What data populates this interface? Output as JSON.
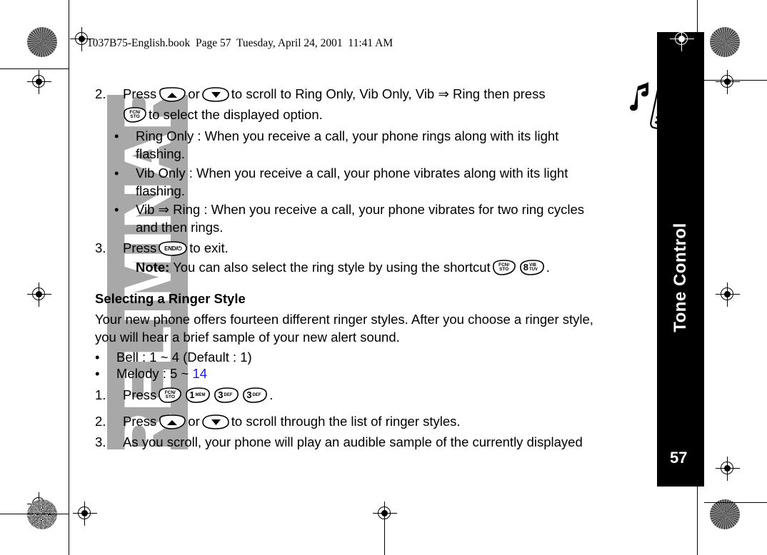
{
  "header": {
    "file_line": "1037B75-English.book  Page 57  Tuesday, April 24, 2001  11:41 AM"
  },
  "watermark": {
    "text": "PRELIMINARY",
    "color": "#a8a8a8"
  },
  "sidebar": {
    "tab_label": "Tone Control",
    "page_number": "57",
    "background": "#000000"
  },
  "keys": {
    "fcn_line1": "FCN/",
    "fcn_line2": "STO",
    "end": "END/⏻",
    "digit_1_num": "1",
    "digit_1_sub": "MEM",
    "digit_3_num": "3",
    "digit_3_sub": "DEF",
    "digit_8_num": "8",
    "digit_8_sub1": "VIB",
    "digit_8_sub2": "TUV"
  },
  "body": {
    "step2_num": "2.",
    "step2_part1": "Press",
    "step2_part2": "or",
    "step2_part3": "to scroll to Ring Only, Vib Only, Vib ⇒ Ring then press",
    "step2_line2": "to select the displayed option.",
    "bullet_marker": "•",
    "b1_line1": "Ring Only : When you receive a call, your phone rings along with its light",
    "b1_line2": "flashing.",
    "b2_line1": "Vib Only : When you receive a call, your phone vibrates along with its light",
    "b2_line2": "flashing.",
    "b3_line1": "Vib ⇒ Ring : When you receive a call, your phone vibrates for two ring cycles",
    "b3_line2": "and then rings.",
    "step3_num": "3.",
    "step3_part1": "Press",
    "step3_part2": "to exit.",
    "note_label": "Note:",
    "note_text1": "You can also select the ring style by using the shortcut",
    "note_text2": ".",
    "section_title": "Selecting a Ringer Style",
    "para_line1": "Your new phone offers fourteen different ringer styles. After you choose a ringer style,",
    "para_line2": "you will hear a brief sample of your new alert sound.",
    "bell_line": "Bell : 1 ~ 4 (Default : 1)",
    "melody_prefix": "Melody : 5 ~ ",
    "melody_value": "14",
    "melody_value_color": "#1a1ae6",
    "s1_num": "1.",
    "s1_text": "Press",
    "s1_period": ".",
    "s2_num": "2.",
    "s2_part1": "Press",
    "s2_part2": "or",
    "s2_part3": "to scroll through the list of ringer styles.",
    "s3_num": "3.",
    "s3_text": "As you scroll, your phone will play an audible sample of the currently displayed"
  }
}
